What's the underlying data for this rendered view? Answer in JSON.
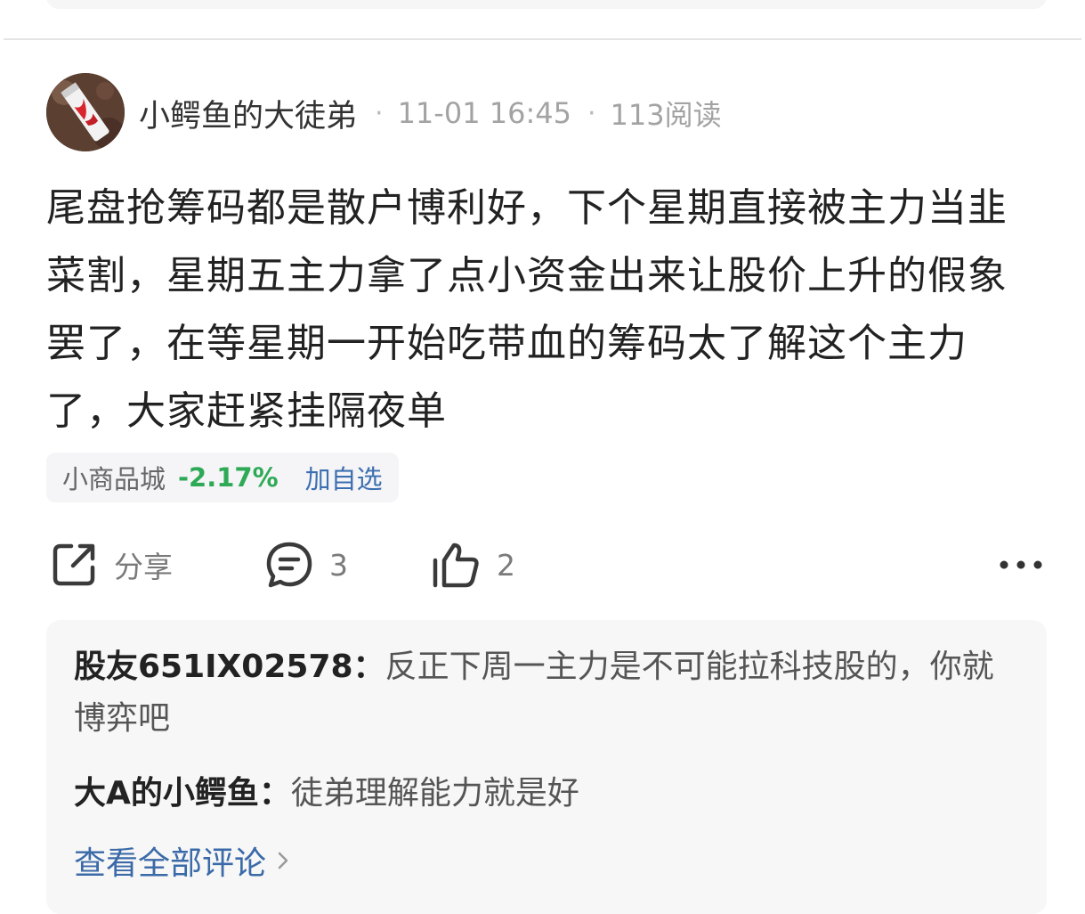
{
  "post": {
    "author": "小鳄鱼的大徒弟",
    "separator": "·",
    "time": "11-01 16:45",
    "reads": "113阅读",
    "content": "尾盘抢筹码都是散户博利好，下个星期直接被主力当韭菜割，星期五主力拿了点小资金出来让股价上升的假象罢了，在等星期一开始吃带血的筹码太了解这个主力了，大家赶紧挂隔夜单"
  },
  "stock": {
    "name": "小商品城",
    "change": "-2.17%",
    "add_label": "加自选"
  },
  "actions": {
    "share_label": "分享",
    "comment_count": "3",
    "like_count": "2",
    "more_icon": "more-dots-icon"
  },
  "comments": {
    "items": [
      {
        "author": "股友651IX02578",
        "text": "反正下周一主力是不可能拉科技股的，你就博弈吧"
      },
      {
        "author": "大A的小鳄鱼",
        "text": "徒弟理解能力就是好"
      }
    ],
    "colon": "：",
    "view_all": "查看全部评论"
  },
  "colors": {
    "text_primary": "#222222",
    "text_meta": "#a3a3a3",
    "stock_down": "#2eaa57",
    "link_blue": "#3a6aa8",
    "panel_bg": "#f7f7f7"
  }
}
